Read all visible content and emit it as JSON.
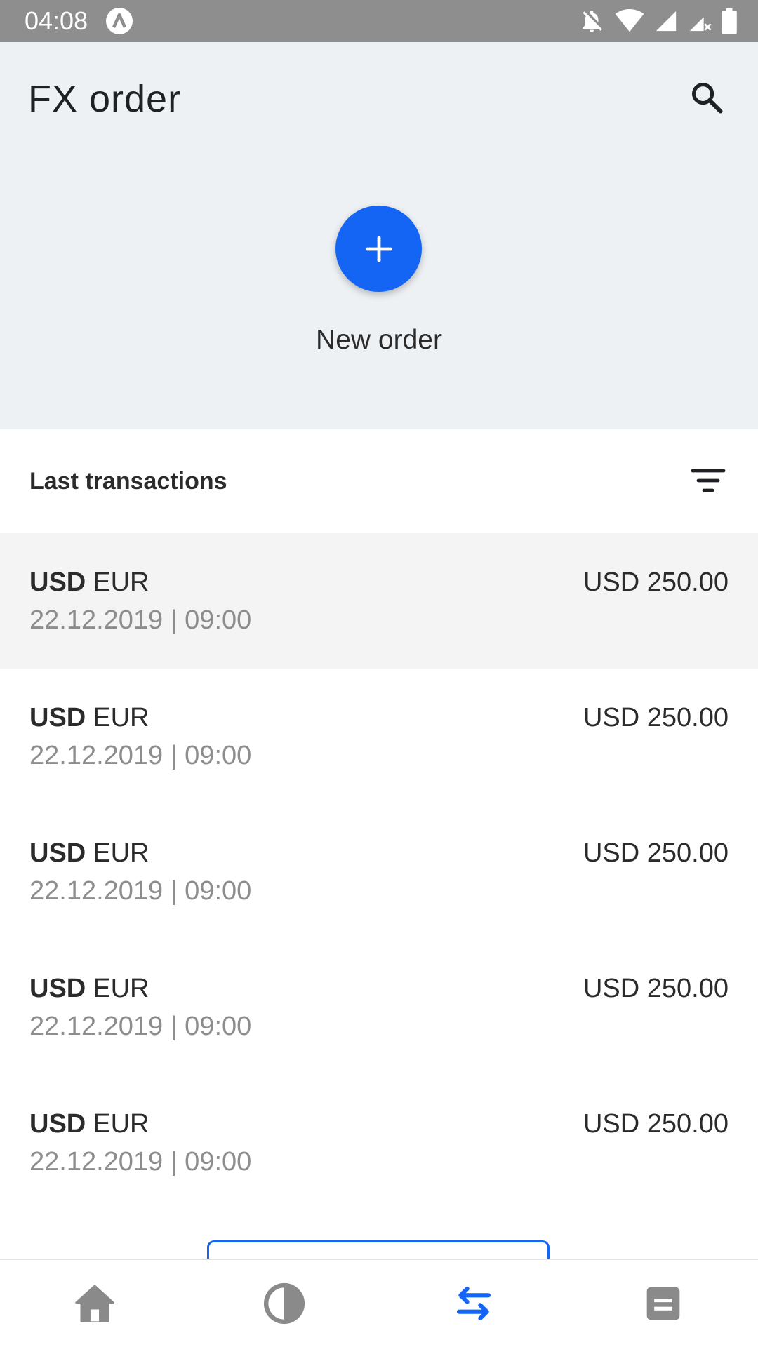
{
  "status_bar": {
    "time": "04:08",
    "icons": [
      "app-a-icon",
      "notifications-off-icon",
      "wifi-icon",
      "signal-icon",
      "signal-no-service-icon",
      "battery-icon"
    ]
  },
  "header": {
    "title": "FX order",
    "search_icon": "search-icon",
    "new_order_label": "New order",
    "new_order_icon": "plus-icon",
    "accent_color": "#1565f4"
  },
  "transactions_section": {
    "title": "Last transactions",
    "filter_icon": "filter-icon"
  },
  "transactions": [
    {
      "base": "USD",
      "quote": "EUR",
      "datetime": "22.12.2019 | 09:00",
      "amount": "USD 250.00",
      "selected": true
    },
    {
      "base": "USD",
      "quote": "EUR",
      "datetime": "22.12.2019 | 09:00",
      "amount": "USD 250.00",
      "selected": false
    },
    {
      "base": "USD",
      "quote": "EUR",
      "datetime": "22.12.2019 | 09:00",
      "amount": "USD 250.00",
      "selected": false
    },
    {
      "base": "USD",
      "quote": "EUR",
      "datetime": "22.12.2019 | 09:00",
      "amount": "USD 250.00",
      "selected": false
    },
    {
      "base": "USD",
      "quote": "EUR",
      "datetime": "22.12.2019 | 09:00",
      "amount": "USD 250.00",
      "selected": false
    }
  ],
  "bottom_nav": {
    "items": [
      {
        "icon": "home-icon",
        "active": false
      },
      {
        "icon": "half-circle-icon",
        "active": false
      },
      {
        "icon": "transfer-arrows-icon",
        "active": true
      },
      {
        "icon": "document-icon",
        "active": false
      }
    ],
    "active_color": "#1565f4",
    "inactive_color": "#8a8a8a"
  }
}
